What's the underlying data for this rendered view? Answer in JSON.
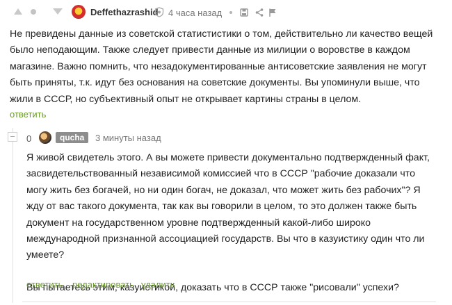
{
  "comment": {
    "author": "Deffethazrashid",
    "time": "4 часа назад",
    "text": "Не превидены данные из советской статистистики о том, действительно ли качество вещей было неподающим. Также следует привести данные из милиции о воровстве в каждом магазине. Важно помнить, что незадокументированные антисоветские заявления не могут быть приняты, т.к. идут без основания на советские документы. Вы упоминули выше, что жили в СССР, но субъективный опыт не открывает картины страны в целом.",
    "reply_label": "ответить"
  },
  "reply": {
    "score": "0",
    "author": "qucha",
    "time": "3 минуты назад",
    "paragraph1": "Я живой свидетель этого. А вы можете привести документально подтвержденный факт, засвидетельствованный независимой комиссией что в СССР \"рабочие доказали что могу жить без богачей, но ни один богач, не доказал, что может жить без рабочих\"? Я жду от вас такого документа, так как вы говорили в целом, то это должен также быть документ на государственном уровне подтвержденный какой-либо широко международной признанной ассоциацией государств. Вы что в казуистику один что ли умеете?",
    "paragraph2": "Вы пытаетесь этим, казуистикой, доказать что в СССР также \"рисовали\" успехи?",
    "actions": {
      "reply": "ответить",
      "edit": "редактировать",
      "delete": "удалить"
    }
  },
  "colors": {
    "link": "#6a9a2a",
    "user_tag_bg": "#8d8d8d",
    "muted": "#777777"
  },
  "icons": [
    "upvote-icon",
    "neutral-vote-icon",
    "downvote-icon",
    "shield-icon",
    "link-icon",
    "save-icon",
    "share-icon",
    "report-flag-icon",
    "collapse-minus-icon"
  ]
}
